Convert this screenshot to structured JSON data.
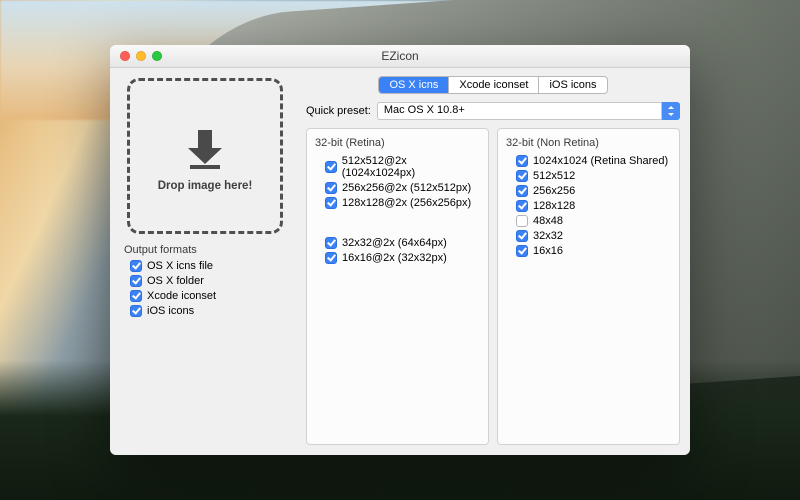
{
  "window": {
    "title": "EZicon"
  },
  "dropzone": {
    "label": "Drop image here!"
  },
  "outputFormats": {
    "heading": "Output formats",
    "items": [
      {
        "label": "OS X icns file",
        "checked": true
      },
      {
        "label": "OS X folder",
        "checked": true
      },
      {
        "label": "Xcode iconset",
        "checked": true
      },
      {
        "label": "iOS icons",
        "checked": true
      }
    ]
  },
  "tabs": [
    {
      "label": "OS X icns",
      "active": true
    },
    {
      "label": "Xcode iconset",
      "active": false
    },
    {
      "label": "iOS icons",
      "active": false
    }
  ],
  "preset": {
    "label": "Quick preset:",
    "value": "Mac OS X 10.8+"
  },
  "retina": {
    "heading": "32-bit (Retina)",
    "group1": [
      {
        "label": "512x512@2x (1024x1024px)",
        "checked": true
      },
      {
        "label": "256x256@2x (512x512px)",
        "checked": true
      },
      {
        "label": "128x128@2x (256x256px)",
        "checked": true
      }
    ],
    "group2": [
      {
        "label": "32x32@2x (64x64px)",
        "checked": true
      },
      {
        "label": "16x16@2x (32x32px)",
        "checked": true
      }
    ]
  },
  "nonretina": {
    "heading": "32-bit (Non Retina)",
    "items": [
      {
        "label": "1024x1024 (Retina Shared)",
        "checked": true
      },
      {
        "label": "512x512",
        "checked": true
      },
      {
        "label": "256x256",
        "checked": true
      },
      {
        "label": "128x128",
        "checked": true
      },
      {
        "label": "48x48",
        "checked": false
      },
      {
        "label": "32x32",
        "checked": true
      },
      {
        "label": "16x16",
        "checked": true
      }
    ]
  }
}
